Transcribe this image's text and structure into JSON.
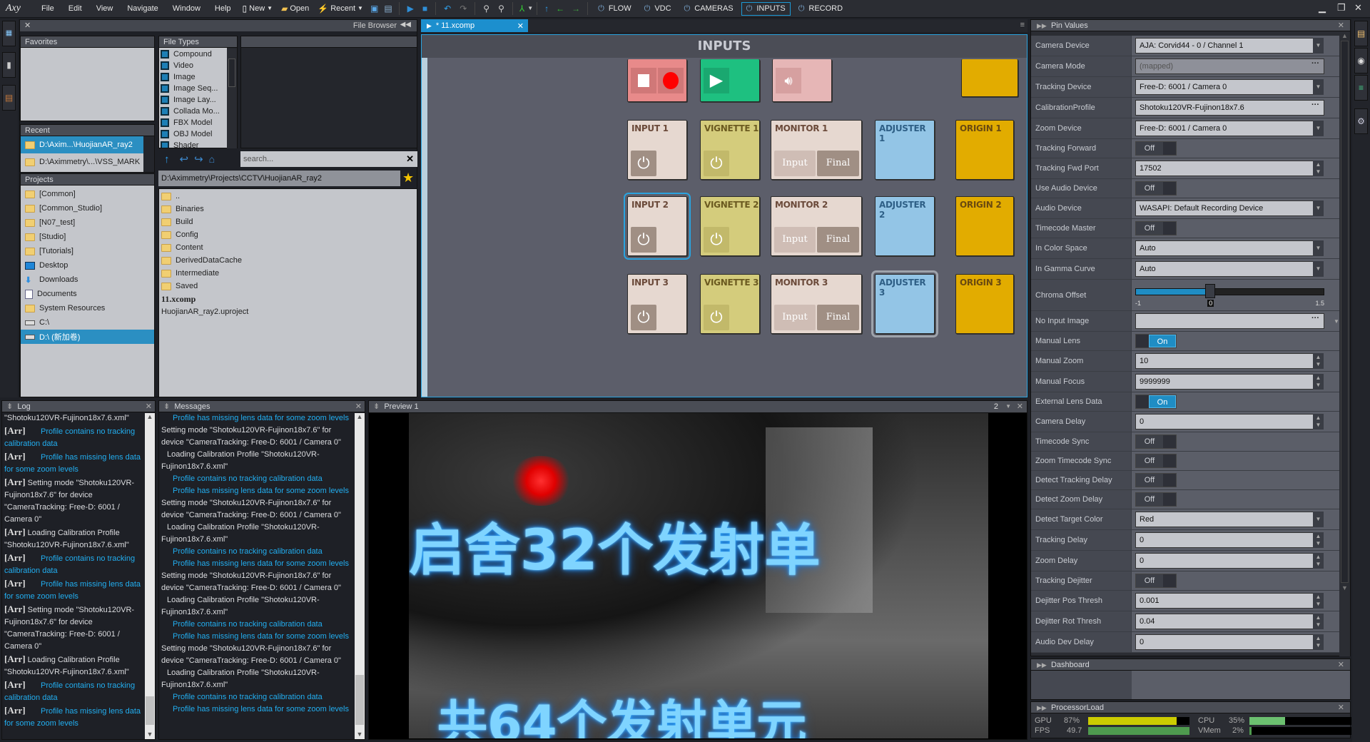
{
  "app": {
    "logo": "Axy"
  },
  "menu": [
    "File",
    "Edit",
    "View",
    "Navigate",
    "Window",
    "Help"
  ],
  "toolbar": {
    "new": "New",
    "open": "Open",
    "recent": "Recent"
  },
  "modes": [
    {
      "label": "FLOW",
      "active": false
    },
    {
      "label": "VDC",
      "active": false
    },
    {
      "label": "CAMERAS",
      "active": false
    },
    {
      "label": "INPUTS",
      "active": true
    },
    {
      "label": "RECORD",
      "active": false
    }
  ],
  "file_browser": {
    "title": "File Browser",
    "favorites_title": "Favorites",
    "recent_title": "Recent",
    "recent": [
      "D:\\Axim...\\HuojianAR_ray2",
      "D:\\Aximmetry\\...\\VSS_MARK"
    ],
    "projects_title": "Projects",
    "projects": [
      "[Common]",
      "[Common_Studio]",
      "[N07_test]",
      "[Studio]",
      "[Tutorials]",
      "Desktop",
      "Downloads",
      "Documents",
      "System Resources",
      "C:\\",
      "D:\\ (新加卷)"
    ],
    "file_types_title": "File Types",
    "file_types": [
      "Compound",
      "Video",
      "Image",
      "Image Seq...",
      "Image Lay...",
      "Collada Mo...",
      "FBX Model",
      "OBJ Model",
      "Shader"
    ],
    "search_placeholder": "search...",
    "path": "D:\\Aximmetry\\Projects\\CCTV\\HuojianAR_ray2",
    "files": [
      {
        "name": "..",
        "type": "folder"
      },
      {
        "name": "Binaries",
        "type": "folder"
      },
      {
        "name": "Build",
        "type": "folder"
      },
      {
        "name": "Config",
        "type": "folder"
      },
      {
        "name": "Content",
        "type": "folder"
      },
      {
        "name": "DerivedDataCache",
        "type": "folder"
      },
      {
        "name": "Intermediate",
        "type": "folder"
      },
      {
        "name": "Saved",
        "type": "folder"
      },
      {
        "name": "11.xcomp",
        "type": "bold"
      },
      {
        "name": "HuojianAR_ray2.uproject",
        "type": "file"
      }
    ]
  },
  "editor": {
    "tab": "* 11.xcomp",
    "title": "INPUTS",
    "cards": {
      "input": [
        "INPUT 1",
        "INPUT 2",
        "INPUT 3"
      ],
      "vignette": [
        "VIGNETTE 1",
        "VIGNETTE 2",
        "VIGNETTE 3"
      ],
      "monitor": [
        "MONITOR 1",
        "MONITOR 2",
        "MONITOR 3"
      ],
      "adjuster": [
        "ADJUSTER 1",
        "ADJUSTER 2",
        "ADJUSTER 3"
      ],
      "origin": [
        "ORIGIN 1",
        "ORIGIN 2",
        "ORIGIN 3"
      ],
      "monitor_input": "Input",
      "monitor_final": "Final"
    },
    "colors": {
      "input": "#e6d8d0",
      "vignette": "#d4cc7c",
      "adjuster": "#93c5e6",
      "origin": "#e2ac00",
      "record": "#e88a8a",
      "play": "#1ec080",
      "audio": "#e6b6b6"
    }
  },
  "log": {
    "title": "Log",
    "entries": [
      {
        "prefix": "",
        "text": "\"Shotoku120VR-Fujinon18x7.6.xml\"",
        "kind": "info"
      },
      {
        "prefix": "[Arr]",
        "text": "Profile contains no tracking calibration data",
        "kind": "warn"
      },
      {
        "prefix": "[Arr]",
        "text": "Profile has missing lens data for some zoom levels",
        "kind": "warn"
      },
      {
        "prefix": "[Arr]",
        "text": "Setting mode \"Shotoku120VR-Fujinon18x7.6\" for device \"CameraTracking: Free-D: 6001 / Camera 0\"",
        "kind": "info"
      },
      {
        "prefix": "[Arr]",
        "text": "Loading Calibration Profile \"Shotoku120VR-Fujinon18x7.6.xml\"",
        "kind": "info"
      },
      {
        "prefix": "[Arr]",
        "text": "Profile contains no tracking calibration data",
        "kind": "warn"
      },
      {
        "prefix": "[Arr]",
        "text": "Profile has missing lens data for some zoom levels",
        "kind": "warn"
      },
      {
        "prefix": "[Arr]",
        "text": "Setting mode \"Shotoku120VR-Fujinon18x7.6\" for device \"CameraTracking: Free-D: 6001 / Camera 0\"",
        "kind": "info"
      },
      {
        "prefix": "[Arr]",
        "text": "Loading Calibration Profile \"Shotoku120VR-Fujinon18x7.6.xml\"",
        "kind": "info"
      },
      {
        "prefix": "[Arr]",
        "text": "Profile contains no tracking calibration data",
        "kind": "warn"
      },
      {
        "prefix": "[Arr]",
        "text": "Profile has missing lens data for some zoom levels",
        "kind": "warn"
      }
    ]
  },
  "messages": {
    "title": "Messages",
    "entries": [
      {
        "text": "Profile has missing lens data for some zoom levels",
        "kind": "warn"
      },
      {
        "text": "Setting mode \"Shotoku120VR-Fujinon18x7.6\" for device \"CameraTracking: Free-D: 6001 / Camera 0\"",
        "kind": "info"
      },
      {
        "text": "Loading Calibration Profile \"Shotoku120VR-Fujinon18x7.6.xml\"",
        "kind": "load"
      },
      {
        "text": "Profile contains no tracking calibration data",
        "kind": "warn"
      },
      {
        "text": "Profile has missing lens data for some zoom levels",
        "kind": "warn"
      },
      {
        "text": "Setting mode \"Shotoku120VR-Fujinon18x7.6\" for device \"CameraTracking: Free-D: 6001 / Camera 0\"",
        "kind": "info"
      },
      {
        "text": "Loading Calibration Profile \"Shotoku120VR-Fujinon18x7.6.xml\"",
        "kind": "load"
      },
      {
        "text": "Profile contains no tracking calibration data",
        "kind": "warn"
      },
      {
        "text": "Profile has missing lens data for some zoom levels",
        "kind": "warn"
      },
      {
        "text": "Setting mode \"Shotoku120VR-Fujinon18x7.6\" for device \"CameraTracking: Free-D: 6001 / Camera 0\"",
        "kind": "info"
      },
      {
        "text": "Loading Calibration Profile \"Shotoku120VR-Fujinon18x7.6.xml\"",
        "kind": "load"
      },
      {
        "text": "Profile contains no tracking calibration data",
        "kind": "warn"
      },
      {
        "text": "Profile has missing lens data for some zoom levels",
        "kind": "warn"
      },
      {
        "text": "Setting mode \"Shotoku120VR-Fujinon18x7.6\" for device \"CameraTracking: Free-D: 6001 / Camera 0\"",
        "kind": "info"
      },
      {
        "text": "Loading Calibration Profile \"Shotoku120VR-Fujinon18x7.6.xml\"",
        "kind": "load"
      },
      {
        "text": "Profile contains no tracking calibration data",
        "kind": "warn"
      },
      {
        "text": "Profile has missing lens data for some zoom levels",
        "kind": "warn"
      }
    ]
  },
  "preview": {
    "title": "Preview 1",
    "monitor_index": "2",
    "overlay_line1": "启舍32个发射单",
    "overlay_line2": "共64个发射单元"
  },
  "pin_values": {
    "title": "Pin Values",
    "pins": [
      {
        "label": "Camera Device",
        "type": "dropdown",
        "value": "AJA: Corvid44 - 0 / Channel 1"
      },
      {
        "label": "Camera Mode",
        "type": "readonly",
        "value": "(mapped)"
      },
      {
        "label": "Tracking Device",
        "type": "dropdown",
        "value": "Free-D: 6001 / Camera 0"
      },
      {
        "label": "CalibrationProfile",
        "type": "browse",
        "value": "Shotoku120VR-Fujinon18x7.6"
      },
      {
        "label": "Zoom Device",
        "type": "dropdown",
        "value": "Free-D: 6001 / Camera 0"
      },
      {
        "label": "Tracking Forward",
        "type": "toggle",
        "value": "Off"
      },
      {
        "label": "Tracking Fwd Port",
        "type": "spin",
        "value": "17502"
      },
      {
        "label": "Use Audio Device",
        "type": "toggle",
        "value": "Off"
      },
      {
        "label": "Audio Device",
        "type": "dropdown",
        "value": "WASAPI: Default Recording Device"
      },
      {
        "label": "Timecode Master",
        "type": "toggle",
        "value": "Off"
      },
      {
        "label": "In Color Space",
        "type": "dropdown",
        "value": "Auto"
      },
      {
        "label": "In Gamma Curve",
        "type": "dropdown",
        "value": "Auto"
      },
      {
        "label": "Chroma Offset",
        "type": "slider",
        "value": "0",
        "min": "-1",
        "max": "1.5"
      },
      {
        "label": "No Input Image",
        "type": "browse",
        "value": ""
      },
      {
        "label": "Manual Lens",
        "type": "toggle",
        "value": "On"
      },
      {
        "label": "Manual Zoom",
        "type": "spin",
        "value": "10"
      },
      {
        "label": "Manual Focus",
        "type": "spin",
        "value": "9999999"
      },
      {
        "label": "External Lens Data",
        "type": "toggle",
        "value": "On"
      },
      {
        "label": "Camera Delay",
        "type": "spin",
        "value": "0"
      },
      {
        "label": "Timecode Sync",
        "type": "toggle",
        "value": "Off"
      },
      {
        "label": "Zoom Timecode Sync",
        "type": "toggle",
        "value": "Off"
      },
      {
        "label": "Detect Tracking Delay",
        "type": "toggle",
        "value": "Off"
      },
      {
        "label": "Detect Zoom Delay",
        "type": "toggle",
        "value": "Off"
      },
      {
        "label": "Detect Target Color",
        "type": "dropdown",
        "value": "Red"
      },
      {
        "label": "Tracking Delay",
        "type": "spin",
        "value": "0"
      },
      {
        "label": "Zoom Delay",
        "type": "spin",
        "value": "0"
      },
      {
        "label": "Tracking Dejitter",
        "type": "toggle",
        "value": "Off"
      },
      {
        "label": "Dejitter Pos Thresh",
        "type": "spin",
        "value": "0.001"
      },
      {
        "label": "Dejitter Rot Thresh",
        "type": "spin",
        "value": "0.04"
      },
      {
        "label": "Audio Dev Delay",
        "type": "spin",
        "value": "0"
      }
    ]
  },
  "dashboard": {
    "title": "Dashboard"
  },
  "processor_load": {
    "title": "ProcessorLoad",
    "gpu_label": "GPU",
    "gpu": "87%",
    "gpu_fraction": 0.87,
    "gpu_color": "#cccc00",
    "fps_label": "FPS",
    "fps": "49.7",
    "fps_fraction": 1.0,
    "fps_color": "#4e9a4e",
    "cpu_label": "CPU",
    "cpu": "35%",
    "cpu_fraction": 0.35,
    "cpu_color": "#6cc070",
    "vmem_label": "VMem",
    "vmem": "2%",
    "vmem_fraction": 0.02,
    "vmem_color": "#4e9a4e"
  }
}
